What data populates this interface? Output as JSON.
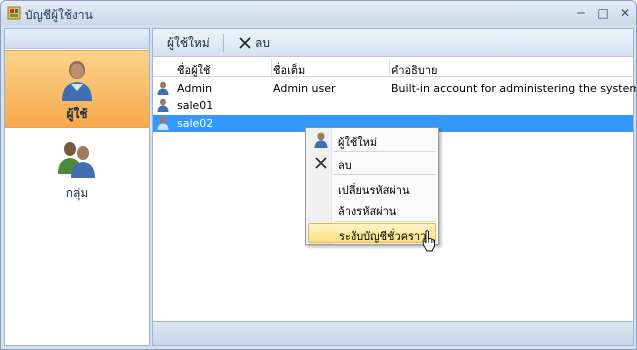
{
  "window": {
    "title": "บัญชีผู้ใช้งาน"
  },
  "nav": {
    "items": [
      {
        "label": "ผู้ใช้",
        "active": true,
        "icon": "user-icon"
      },
      {
        "label": "กลุ่ม",
        "active": false,
        "icon": "group-icon"
      }
    ]
  },
  "toolbar": {
    "new_label": "ผู้ใช้ใหม่",
    "delete_label": "ลบ"
  },
  "table": {
    "columns": [
      "ชื่อผู้ใช้",
      "ชื่อเต็ม",
      "คำอธิบาย"
    ],
    "rows": [
      {
        "username": "Admin",
        "fullname": "Admin user",
        "description": "Built-in account for administering the system"
      },
      {
        "username": "sale01",
        "fullname": "",
        "description": ""
      },
      {
        "username": "sale02",
        "fullname": "",
        "description": "",
        "selected": true
      }
    ]
  },
  "context_menu": {
    "items": [
      {
        "label": "ผู้ใช้ใหม่",
        "icon": "user-icon"
      },
      {
        "label": "ลบ",
        "icon": "close-icon"
      },
      {
        "label": "เปลี่ยนรหัสผ่าน"
      },
      {
        "label": "ล้างรหัสผ่าน"
      },
      {
        "label": "ระงับบัญชีชั่วคราว",
        "hover": true
      }
    ]
  },
  "colors": {
    "accent": "#3399ff",
    "nav_active": "#f7a94a",
    "menu_hover": "#fbdf7e"
  }
}
